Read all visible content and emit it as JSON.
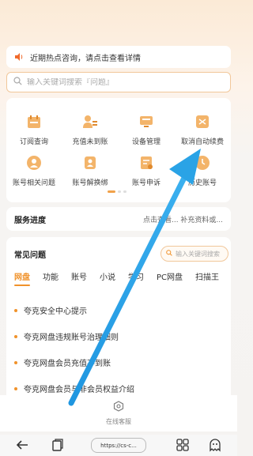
{
  "notice": {
    "text": "近期热点咨询，请点击查看详情"
  },
  "search": {
    "placeholder": "输入关键词搜索『问题』"
  },
  "services": [
    {
      "label": "订阅查询",
      "icon": "subscription-icon"
    },
    {
      "label": "充值未到账",
      "icon": "recharge-icon"
    },
    {
      "label": "设备管理",
      "icon": "device-icon"
    },
    {
      "label": "取消自动续费",
      "icon": "cancel-renewal-icon"
    },
    {
      "label": "账号相关问题",
      "icon": "account-icon"
    },
    {
      "label": "账号解换绑",
      "icon": "unbind-icon"
    },
    {
      "label": "账号申诉",
      "icon": "appeal-icon"
    },
    {
      "label": "历史账号",
      "icon": "history-account-icon"
    }
  ],
  "progress": {
    "title": "服务进度",
    "hint": "点击查看... 补充资料或..."
  },
  "faq": {
    "title": "常见问题",
    "search_placeholder": "输入关键词搜索",
    "tabs": [
      "网盘",
      "功能",
      "账号",
      "小说",
      "学习",
      "PC网盘",
      "扫描王"
    ],
    "questions": [
      "夸克安全中心提示",
      "夸克网盘违规账号治理细则",
      "夸克网盘会员充值不到账",
      "夸克网盘会员与非会员权益介绍"
    ]
  },
  "online": {
    "label": "在线客服"
  },
  "navbar": {
    "url": "https://cs-c..."
  },
  "colors": {
    "accent": "#f0922b",
    "arrow": "#2aa3e6"
  }
}
